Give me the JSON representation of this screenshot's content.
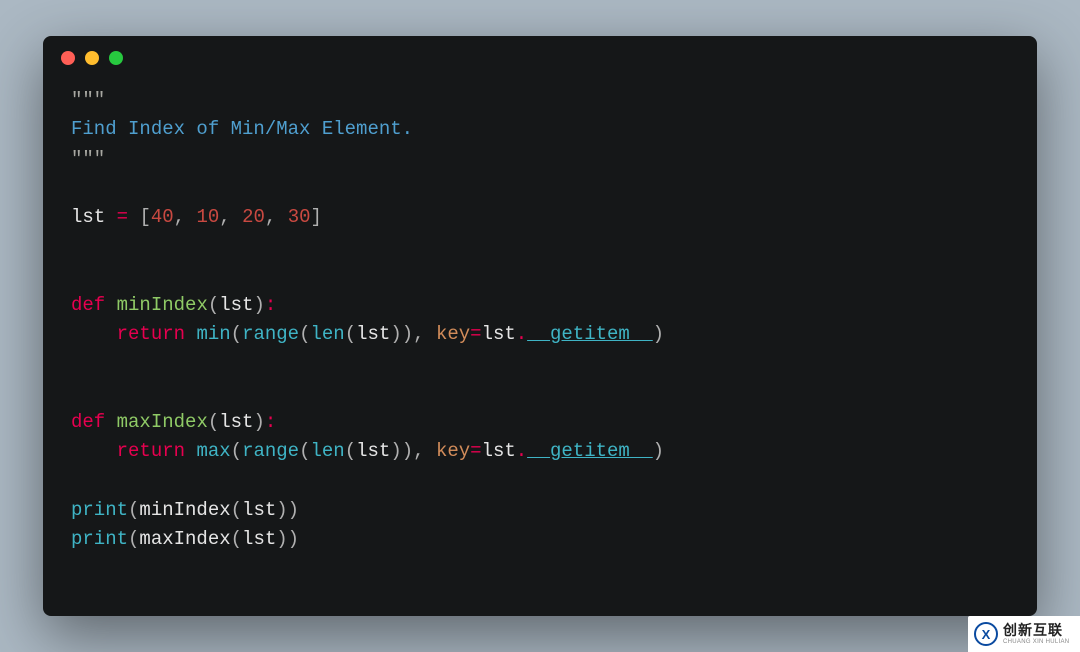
{
  "window": {
    "buttons": [
      "close",
      "minimize",
      "zoom"
    ]
  },
  "code": {
    "docstring_open": "\"\"\"",
    "docstring_body": "Find Index of Min/Max Element.",
    "docstring_close": "\"\"\"",
    "assign_lhs": "lst",
    "assign_op": " = ",
    "list_open": "[",
    "list_vals": [
      "40",
      "10",
      "20",
      "30"
    ],
    "list_sep": ", ",
    "list_close": "]",
    "kw_def": "def",
    "kw_return": "return",
    "fn_min_name": "minIndex",
    "fn_max_name": "maxIndex",
    "param": "lst",
    "bi_min": "min",
    "bi_max": "max",
    "bi_range": "range",
    "bi_len": "len",
    "kw_key": "key",
    "dunder": "__getitem__",
    "bi_print": "print"
  },
  "watermark": {
    "logo_letter": "X",
    "cn": "创新互联",
    "en": "CHUANG XIN HULIAN"
  }
}
